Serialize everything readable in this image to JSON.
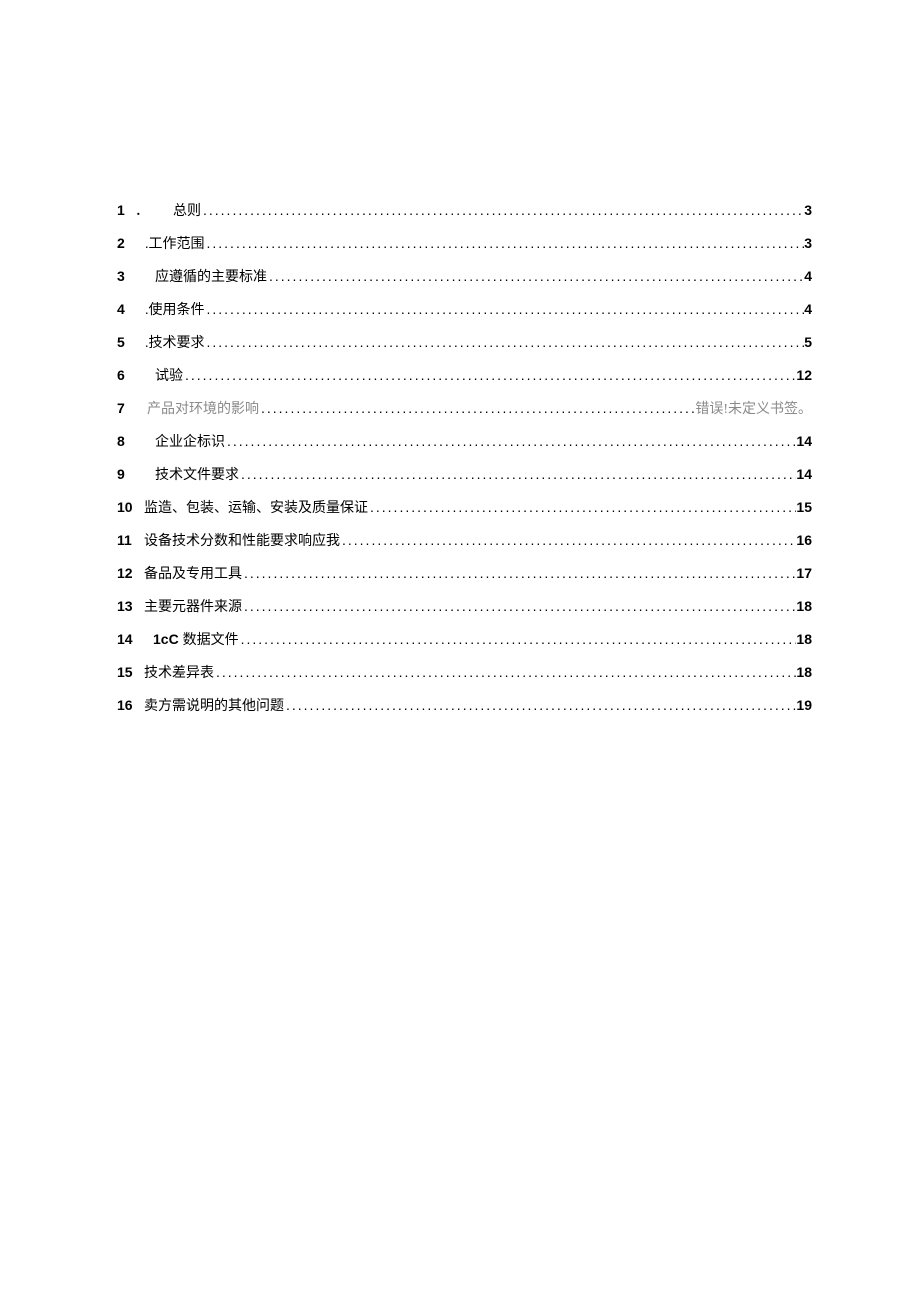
{
  "toc": [
    {
      "num": "1",
      "prefix": "．",
      "spacer": 24,
      "title": "总则",
      "page": "3",
      "pageIsNum": true,
      "numOnly": true
    },
    {
      "num": "2",
      "prefix": "",
      "spacer": 10,
      "title": ".工作范围",
      "page": "3",
      "pageIsNum": true,
      "numOnly": true
    },
    {
      "num": "3",
      "prefix": "",
      "spacer": 20,
      "title": "应遵循的主要标准",
      "page": "4",
      "pageIsNum": true,
      "numOnly": true
    },
    {
      "num": "4",
      "prefix": "",
      "spacer": 10,
      "title": ".使用条件",
      "page": "4",
      "pageIsNum": true,
      "numOnly": true
    },
    {
      "num": "5",
      "prefix": "",
      "spacer": 10,
      "title": ".技术要求",
      "page": "5",
      "pageIsNum": true,
      "numOnly": true
    },
    {
      "num": "6",
      "prefix": "",
      "spacer": 20,
      "title": "试验",
      "page": "12",
      "pageIsNum": true,
      "numOnly": true
    },
    {
      "num": "7",
      "prefix": "",
      "spacer": 12,
      "title": "产品对环境的影响",
      "page": "错误!未定义书签。",
      "pageIsNum": false,
      "numOnly": true,
      "faded": true
    },
    {
      "num": "8",
      "prefix": "",
      "spacer": 20,
      "title": "企业企标识",
      "page": "14",
      "pageIsNum": true,
      "numOnly": true
    },
    {
      "num": "9",
      "prefix": "",
      "spacer": 20,
      "title": "技术文件要求",
      "page": "14",
      "pageIsNum": true,
      "numOnly": true
    },
    {
      "num": "10",
      "prefix": "",
      "spacer": 1,
      "title": "监造、包装、运输、安装及质量保证",
      "page": "15",
      "pageIsNum": true,
      "numOnly": false
    },
    {
      "num": "11",
      "prefix": "",
      "spacer": 1,
      "title": "设备技术分数和性能要求响应我",
      "page": "16",
      "pageIsNum": true,
      "numOnly": false
    },
    {
      "num": "12",
      "prefix": "",
      "spacer": 1,
      "title": "备品及专用工具",
      "page": "17",
      "pageIsNum": true,
      "numOnly": false
    },
    {
      "num": "13",
      "prefix": "",
      "spacer": 1,
      "title": "主要元器件来源",
      "page": "18",
      "pageIsNum": true,
      "numOnly": false
    },
    {
      "num": "14",
      "prefix": "",
      "spacer": 10,
      "title": "1cC 数据文件",
      "page": "18",
      "pageIsNum": true,
      "numOnly": false,
      "titleBoldPrefix": "1cC"
    },
    {
      "num": "15",
      "prefix": "",
      "spacer": 1,
      "title": "技术差异表",
      "page": "18",
      "pageIsNum": true,
      "numOnly": false
    },
    {
      "num": "16",
      "prefix": "",
      "spacer": 1,
      "title": "卖方需说明的其他问题",
      "page": "19",
      "pageIsNum": true,
      "numOnly": false
    }
  ],
  "dots": "........................................................................................................................................"
}
